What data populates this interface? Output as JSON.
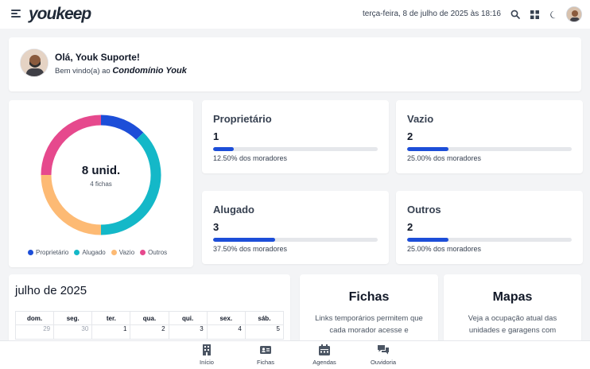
{
  "header": {
    "logo": "youkeep",
    "datetime": "terça-feira, 8 de julho de 2025 às 18:16",
    "icons": [
      "menu-icon",
      "search-icon",
      "grid-icon",
      "moon-icon"
    ]
  },
  "welcome": {
    "greeting": "Olá, Youk Suporte!",
    "subtitle_prefix": "Bem vindo(a) ao",
    "condo_name": "Condomínio Youk"
  },
  "occupancy": {
    "total_label": "8 unid.",
    "fichas_label": "4 fichas",
    "legend": [
      {
        "label": "Proprietário",
        "color": "#1d4ed8"
      },
      {
        "label": "Alugado",
        "color": "#14b8c8"
      },
      {
        "label": "Vazio",
        "color": "#fdba74"
      },
      {
        "label": "Outros",
        "color": "#e6498d"
      }
    ]
  },
  "chart_data": {
    "type": "pie",
    "categories": [
      "Proprietário",
      "Alugado",
      "Vazio",
      "Outros"
    ],
    "values": [
      1,
      3,
      2,
      2
    ],
    "colors": [
      "#1d4ed8",
      "#14b8c8",
      "#fdba74",
      "#e6498d"
    ],
    "title": "8 unid.",
    "subtitle": "4 fichas",
    "legend": "bottom"
  },
  "stats": [
    {
      "title": "Proprietário",
      "value": "1",
      "fraction": 0.125,
      "caption": "12.50% dos moradores"
    },
    {
      "title": "Vazio",
      "value": "2",
      "fraction": 0.25,
      "caption": "25.00% dos moradores"
    },
    {
      "title": "Alugado",
      "value": "3",
      "fraction": 0.375,
      "caption": "37.50% dos moradores"
    },
    {
      "title": "Outros",
      "value": "2",
      "fraction": 0.25,
      "caption": "25.00% dos moradores"
    }
  ],
  "calendar": {
    "title": "julho de 2025",
    "weekdays": [
      "dom.",
      "seg.",
      "ter.",
      "qua.",
      "qui.",
      "sex.",
      "sáb."
    ],
    "first_row": [
      "29",
      "30",
      "1",
      "2",
      "3",
      "4",
      "5"
    ]
  },
  "promos": {
    "fichas": {
      "title": "Fichas",
      "text": "Links temporários permitem que cada morador acesse e"
    },
    "mapas": {
      "title": "Mapas",
      "text": "Veja a ocupação atual das unidades e garagens com"
    }
  },
  "bottom_nav": [
    {
      "label": "Início",
      "icon": "building-icon"
    },
    {
      "label": "Fichas",
      "icon": "id-card-icon"
    },
    {
      "label": "Agendas",
      "icon": "calendar-icon"
    },
    {
      "label": "Ouvidoria",
      "icon": "chat-icon"
    }
  ]
}
